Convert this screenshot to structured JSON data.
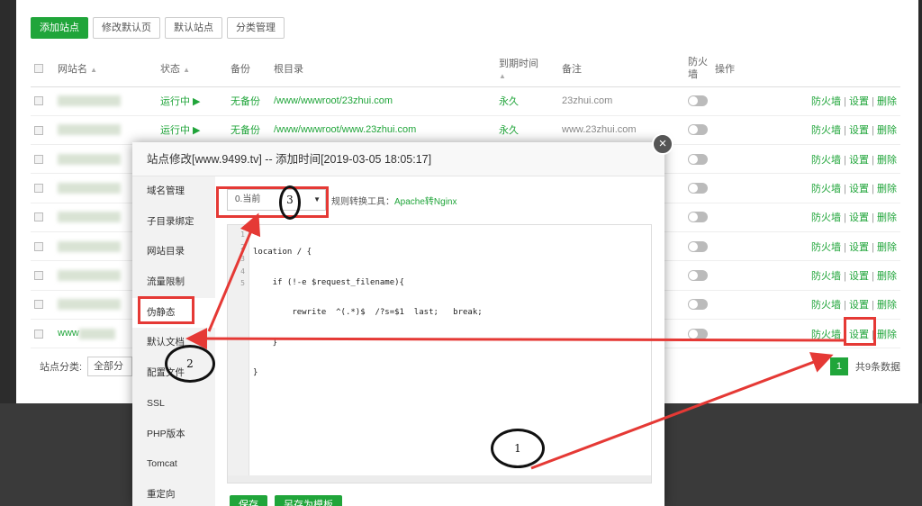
{
  "toolbar": {
    "add_site": "添加站点",
    "edit_default_page": "修改默认页",
    "default_site": "默认站点",
    "category_manage": "分类管理"
  },
  "table": {
    "headers": {
      "site_name": "网站名",
      "status": "状态",
      "backup": "备份",
      "root": "根目录",
      "expire": "到期时间",
      "note": "备注",
      "firewall": "防火墙",
      "ops": "操作"
    },
    "rows": [
      {
        "status": "运行中 ▶",
        "backup": "无备份",
        "root": "/www/wwwroot/23zhui.com",
        "expire": "永久",
        "note": "23zhui.com"
      },
      {
        "status": "运行中 ▶",
        "backup": "无备份",
        "root": "/www/wwwroot/www.23zhui.com",
        "expire": "永久",
        "note": "www.23zhui.com"
      }
    ],
    "partial_row_name": "www",
    "op_firewall": "防火墙",
    "op_settings": "设置",
    "op_delete": "删除"
  },
  "footer": {
    "category_label": "站点分类:",
    "category_value": "全部分类",
    "page_current": "1",
    "total": "共9条数据"
  },
  "modal": {
    "title": "站点修改[www.9499.tv] -- 添加时间[2019-03-05 18:05:17]",
    "side_items": [
      "域名管理",
      "子目录绑定",
      "网站目录",
      "流量限制",
      "伪静态",
      "默认文档",
      "配置文件",
      "SSL",
      "PHP版本",
      "Tomcat",
      "重定向"
    ],
    "rule_select": "0.当前",
    "rule_tip_prefix": "规则转换工具：",
    "rule_tip_link": "Apache转Nginx",
    "code_lines": [
      "location / {",
      "    if (!-e $request_filename){",
      "        rewrite  ^(.*)$  /?s=$1  last;   break;",
      "    }",
      "}"
    ],
    "line_numbers": [
      "1",
      "2",
      "3",
      "4",
      "5"
    ],
    "save": "保存",
    "save_as_template": "另存为模板"
  },
  "annotations": {
    "num1": "1",
    "num2": "2",
    "num3": "3"
  },
  "colors": {
    "accent": "#20a53a",
    "annotation_red": "#e53935"
  }
}
